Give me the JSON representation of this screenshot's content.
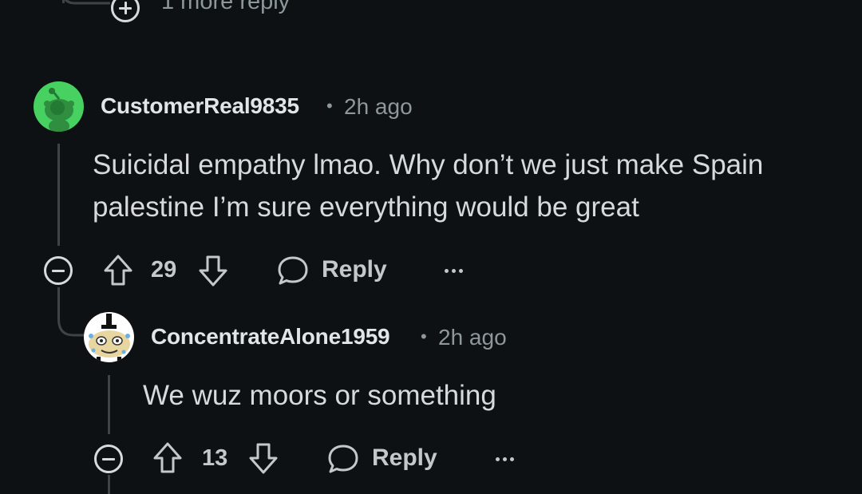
{
  "top": {
    "more_reply_label": "1 more reply"
  },
  "comments": [
    {
      "username": "CustomerReal9835",
      "separator": "•",
      "time": "2h ago",
      "body_lines": [
        "Suicidal empathy lmao. Why don’t we just make Spain",
        "palestine I’m sure everything would be great"
      ],
      "votes": "29",
      "reply_label": "Reply",
      "avatar_color": "#46d160"
    },
    {
      "username": "ConcentrateAlone1959",
      "separator": "•",
      "time": "2h ago",
      "body_lines": [
        "We wuz moors or something"
      ],
      "votes": "13",
      "reply_label": "Reply",
      "avatar_color": "#ffffff"
    }
  ],
  "colors": {
    "background": "#0e1113",
    "text": "#d7dadc",
    "meta": "#8e979c",
    "thread_line": "#3e4346"
  },
  "icons": [
    "plus-circle-icon",
    "minus-circle-icon",
    "upvote-icon",
    "downvote-icon",
    "comment-bubble-icon",
    "more-options-icon",
    "snoo-avatar-icon"
  ]
}
